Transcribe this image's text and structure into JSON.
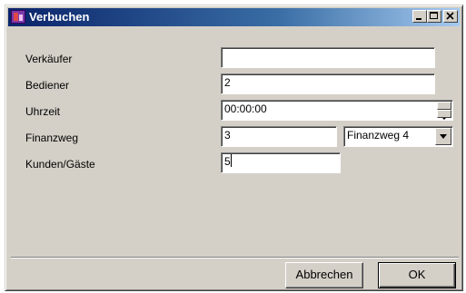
{
  "window": {
    "title": "Verbuchen",
    "icon": "app-icon"
  },
  "titlebar_buttons": {
    "minimize": "minimize-icon",
    "maximize": "maximize-icon",
    "close": "close-icon"
  },
  "form": {
    "verkaeufer": {
      "label": "Verkäufer",
      "value": ""
    },
    "bediener": {
      "label": "Bediener",
      "value": "2"
    },
    "uhrzeit": {
      "label": "Uhrzeit",
      "value": "00:00:00"
    },
    "finanzweg": {
      "label": "Finanzweg",
      "value": "3",
      "selected": "Finanzweg 4"
    },
    "kunden": {
      "label": "Kunden/Gäste",
      "value": "5"
    }
  },
  "buttons": {
    "cancel": "Abbrechen",
    "ok": "OK"
  },
  "colors": {
    "titlebar_start": "#0a246a",
    "titlebar_end": "#a6caf0",
    "face": "#d4d0c8"
  }
}
